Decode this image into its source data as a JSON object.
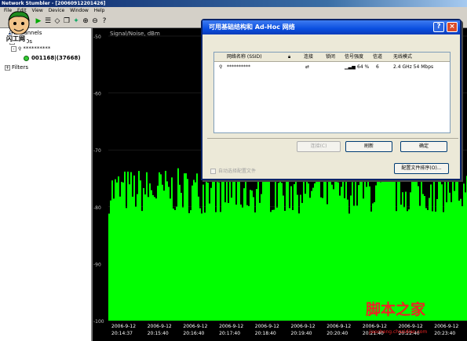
{
  "window": {
    "title": "Network Stumbler - [20060912201426]"
  },
  "menu": [
    "File",
    "Edit",
    "View",
    "Device",
    "Window",
    "Help"
  ],
  "logo": {
    "text": "闪工网"
  },
  "tree": {
    "items": [
      {
        "label": "Channels",
        "exp": "+"
      },
      {
        "label": "SSIDs",
        "exp": "-"
      },
      {
        "label": "**********",
        "exp": "-"
      },
      {
        "label": "001168|(37668)",
        "exp": ""
      },
      {
        "label": "Filters",
        "exp": "+"
      }
    ]
  },
  "chart": {
    "axis_title": "Signal/Noise, dBm",
    "y_ticks": [
      "-50",
      "-60",
      "-70",
      "-80",
      "-90",
      "-100"
    ],
    "x_labels": [
      {
        "date": "2006-9-12",
        "time": "20:14:37"
      },
      {
        "date": "2006-9-12",
        "time": "20:15:40"
      },
      {
        "date": "2006-9-12",
        "time": "20:16:40"
      },
      {
        "date": "2006-9-12",
        "time": "20:17:40"
      },
      {
        "date": "2006-9-12",
        "time": "20:18:40"
      },
      {
        "date": "2006-9-12",
        "time": "20:19:40"
      },
      {
        "date": "2006-9-12",
        "time": "20:20:40"
      },
      {
        "date": "2006-9-12",
        "time": "20:21:40"
      },
      {
        "date": "2006-9-12",
        "time": "20:22:40"
      },
      {
        "date": "2006-9-12",
        "time": "20:23:40"
      }
    ],
    "bar_color": "#00ff00"
  },
  "chart_data": {
    "type": "area",
    "title": "",
    "ylabel": "Signal/Noise, dBm",
    "ylim": [
      -100,
      -50
    ],
    "signal_range": [
      -82,
      -67
    ],
    "typical_level": -78,
    "color": "#00ff00"
  },
  "dialog": {
    "title": "可用基础结构和 Ad-Hoc 网络",
    "help": "?",
    "close": "×",
    "columns": [
      "网络名称 (SSID)",
      "",
      "连接",
      "锁闭",
      "信号强度",
      "信道",
      "无线模式"
    ],
    "row": {
      "ssid": "**********",
      "signal": "64 %",
      "channel": "6",
      "mode": "2.4 GHz 54 Mbps"
    },
    "buttons": {
      "connect": "连接(C)",
      "refresh": "刷新",
      "ok": "确定",
      "config_order": "配置文件排序(O)..."
    },
    "auto_select": "自动选择配置文件"
  },
  "watermark": {
    "big": "脚本之家",
    "small": "jiaocheng.chazidian.com"
  }
}
